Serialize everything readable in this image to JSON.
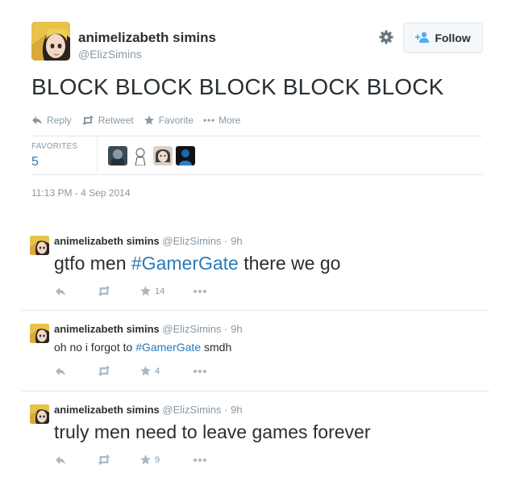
{
  "main_tweet": {
    "author_name": "animelizabeth simins",
    "author_handle": "@ElizSimins",
    "follow_label": "Follow",
    "text": "BLOCK BLOCK BLOCK BLOCK BLOCK",
    "actions": {
      "reply": "Reply",
      "retweet": "Retweet",
      "favorite": "Favorite",
      "more": "More"
    },
    "stats": {
      "favorites_label": "FAVORITES",
      "favorites_count": "5"
    },
    "timestamp": "11:13 PM - 4 Sep 2014"
  },
  "replies": [
    {
      "author_name": "animelizabeth simins",
      "author_handle": "@ElizSimins",
      "time": "· 9h",
      "text_before": "gtfo men ",
      "hashtag": "#GamerGate",
      "text_after": " there we go",
      "favorites": "14"
    },
    {
      "author_name": "animelizabeth simins",
      "author_handle": "@ElizSimins",
      "time": "· 9h",
      "text_before": "oh no i forgot to ",
      "hashtag": "#GamerGate",
      "text_after": " smdh",
      "favorites": "4"
    },
    {
      "author_name": "animelizabeth simins",
      "author_handle": "@ElizSimins",
      "time": "· 9h",
      "text_before": "truly men need to leave games forever",
      "hashtag": "",
      "text_after": "",
      "favorites": "9"
    }
  ],
  "colors": {
    "text": "#292f33",
    "muted": "#8899a6",
    "link": "#2b7bb9",
    "border": "#e1e8ed"
  }
}
